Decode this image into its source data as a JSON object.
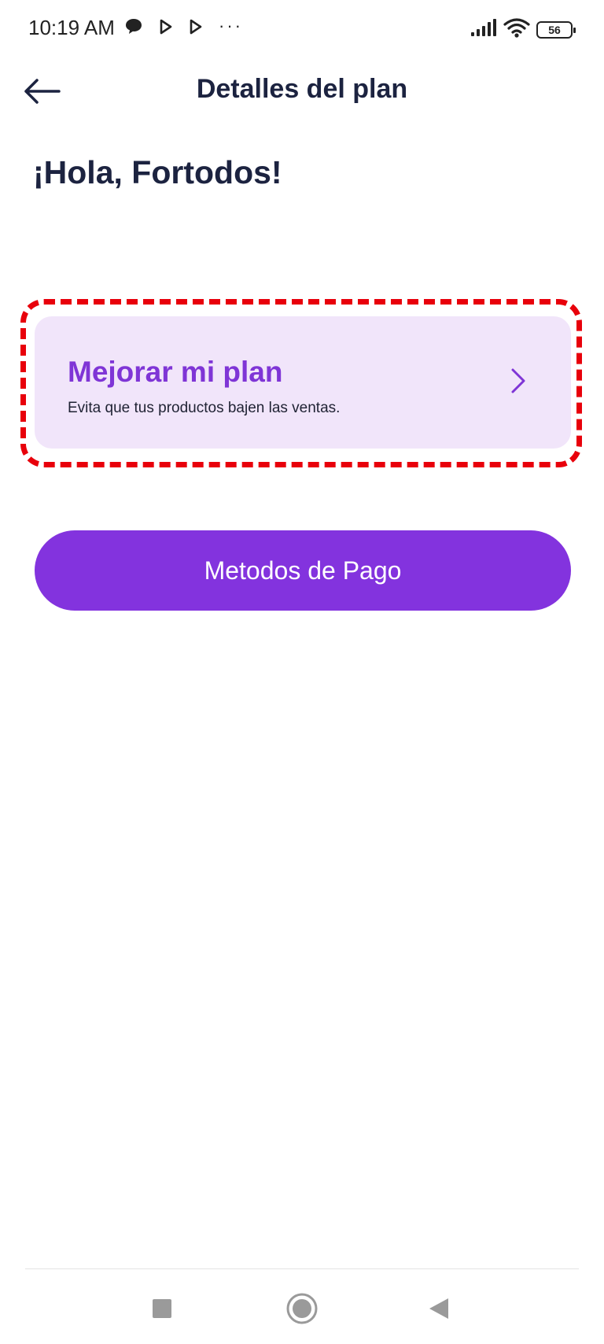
{
  "status_bar": {
    "time": "10:19 AM",
    "dots": "···",
    "battery": "56",
    "icons": [
      "chat-bubble-icon",
      "play-icon",
      "play-icon",
      "signal-icon",
      "wifi-icon",
      "battery-icon"
    ]
  },
  "header": {
    "title": "Detalles del plan",
    "back_icon": "arrow-left-icon"
  },
  "greeting": "¡Hola, Fortodos!",
  "upgrade_card": {
    "title": "Mejorar mi plan",
    "subtitle": "Evita que tus productos bajen las ventas.",
    "icon": "chevron-right-icon"
  },
  "payment_button": {
    "label": "Metodos de Pago"
  },
  "nav_bar": {
    "icons": [
      "square-icon",
      "circle-icon",
      "triangle-back-icon"
    ]
  },
  "colors": {
    "primary": "#8333de",
    "accent_text": "#7f35d6",
    "card_background": "#f1e5fa",
    "highlight_outline": "#e8000b",
    "title_text": "#1c2340"
  }
}
